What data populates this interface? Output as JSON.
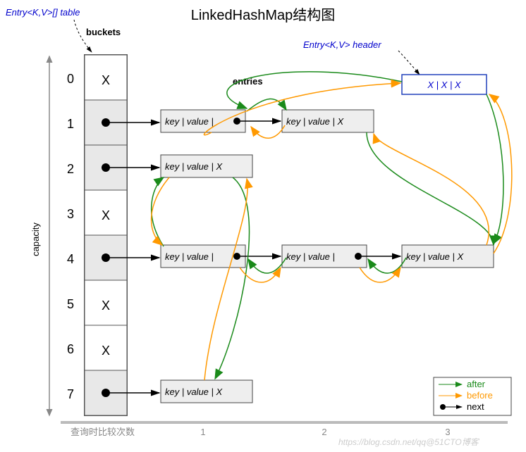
{
  "title": "LinkedHashMap结构图",
  "labels": {
    "table": "Entry<K,V>[] table",
    "buckets": "buckets",
    "header": "Entry<K,V> header",
    "entries": "entries",
    "capacity": "capacity",
    "compare": "查询时比较次数"
  },
  "indices": [
    "0",
    "1",
    "2",
    "3",
    "4",
    "5",
    "6",
    "7"
  ],
  "bucket_content": [
    "X",
    "•",
    "•",
    "X",
    "•",
    "X",
    "X",
    "•"
  ],
  "entry_txt": "key | value |",
  "entry_end": "X",
  "header_cell": "X | X | X",
  "axis_ticks": [
    "1",
    "2",
    "3"
  ],
  "legend": {
    "after": "after",
    "before": "before",
    "next": "next"
  },
  "watermark": "https://blog.csdn.net/qq@51CTO博客",
  "chart_data": {
    "type": "diagram",
    "structure": "LinkedHashMap",
    "capacity": 8,
    "buckets": [
      {
        "index": 0,
        "empty": true
      },
      {
        "index": 1,
        "chain": [
          "key|value",
          "key|value|X"
        ]
      },
      {
        "index": 2,
        "chain": [
          "key|value|X"
        ]
      },
      {
        "index": 3,
        "empty": true
      },
      {
        "index": 4,
        "chain": [
          "key|value",
          "key|value",
          "key|value|X"
        ]
      },
      {
        "index": 5,
        "empty": true
      },
      {
        "index": 6,
        "empty": true
      },
      {
        "index": 7,
        "chain": [
          "key|value|X"
        ]
      }
    ],
    "header_node": "X|X|X",
    "linked_list_pointers": [
      "after(green)",
      "before(orange)",
      "next(black)"
    ],
    "x_axis_meaning": "comparison count on lookup",
    "x_axis_ticks": [
      1,
      2,
      3
    ]
  }
}
